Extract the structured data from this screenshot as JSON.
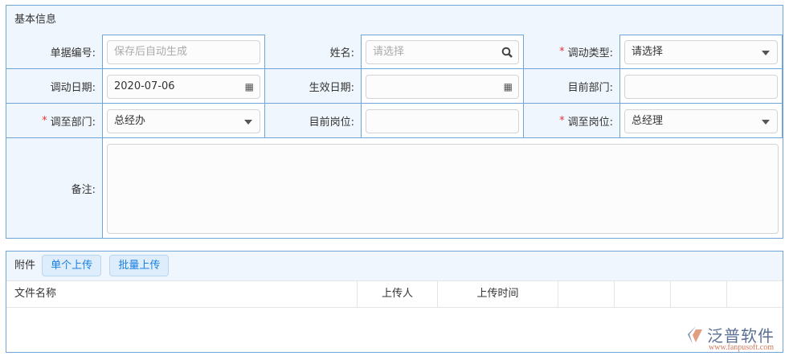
{
  "basic": {
    "title": "基本信息",
    "doc_no": {
      "label": "单据编号:",
      "placeholder": "保存后自动生成"
    },
    "name": {
      "label": "姓名:",
      "placeholder": "请选择"
    },
    "transfer_type": {
      "label": "调动类型:",
      "value": "请选择"
    },
    "transfer_date": {
      "label": "调动日期:",
      "value": "2020-07-06"
    },
    "effective_date": {
      "label": "生效日期:",
      "value": ""
    },
    "current_dept": {
      "label": "目前部门:",
      "value": ""
    },
    "target_dept": {
      "label": "调至部门:",
      "value": "总经办"
    },
    "current_post": {
      "label": "目前岗位:",
      "value": ""
    },
    "target_post": {
      "label": "调至岗位:",
      "value": "总经理"
    },
    "remark": {
      "label": "备注:",
      "value": ""
    }
  },
  "attachments": {
    "title": "附件",
    "single_upload": "单个上传",
    "batch_upload": "批量上传",
    "columns": [
      "文件名称",
      "上传人",
      "上传时间",
      "",
      "",
      "",
      ""
    ]
  },
  "watermark": {
    "brand": "泛普软件",
    "url": "www.fanpusoft.com"
  }
}
